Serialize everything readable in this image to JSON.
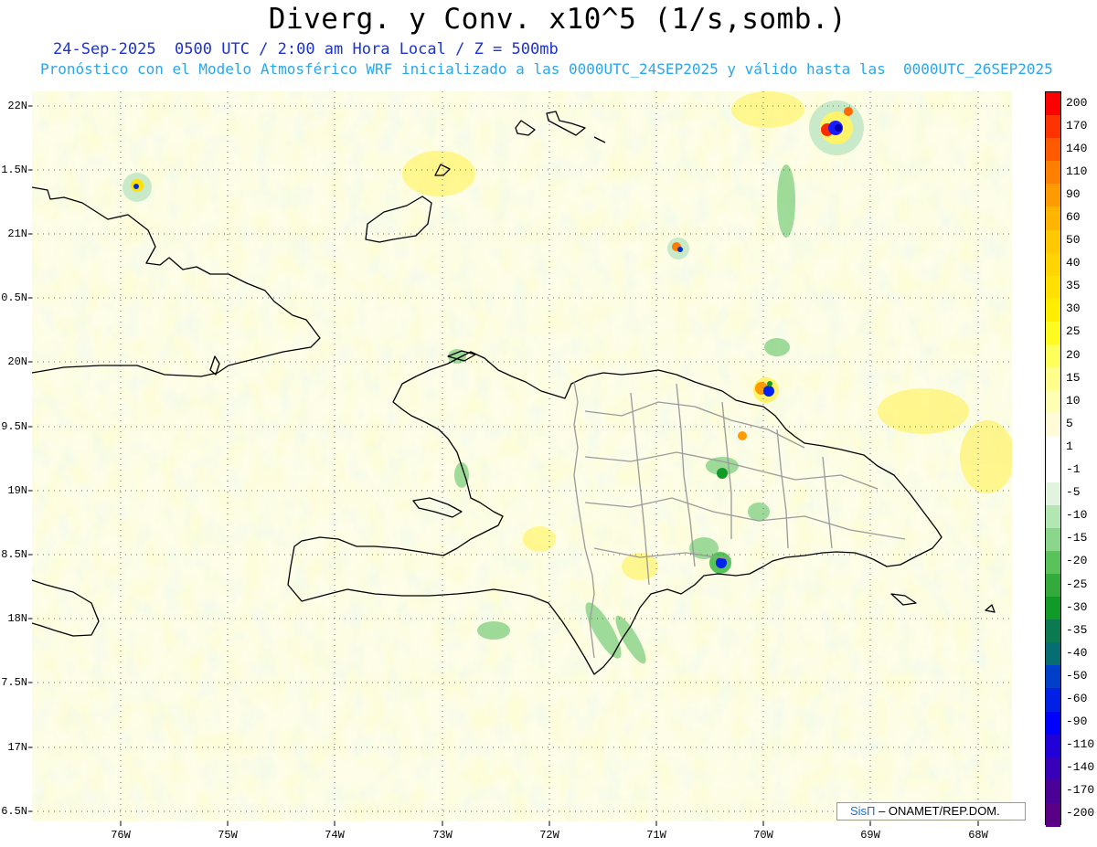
{
  "header": {
    "title": "Diverg. y Conv. x10^5 (1/s,somb.)",
    "subtitle_line1": "24-Sep-2025  0500 UTC / 2:00 am Hora Local / Z = 500mb",
    "subtitle_line2": "Pronóstico con el Modelo Atmosférico WRF inicializado a las 0000UTC_24SEP2025 y válido hasta las  0000UTC_26SEP2025"
  },
  "axes": {
    "lat_labels": [
      "22N",
      "1.5N",
      "21N",
      "0.5N",
      "20N",
      "9.5N",
      "19N",
      "8.5N",
      "18N",
      "7.5N",
      "17N",
      "6.5N"
    ],
    "lon_labels": [
      "76W",
      "75W",
      "74W",
      "73W",
      "72W",
      "71W",
      "70W",
      "69W",
      "68W"
    ]
  },
  "colorbar": {
    "labels": [
      "200",
      "170",
      "140",
      "110",
      "90",
      "60",
      "50",
      "40",
      "35",
      "30",
      "25",
      "20",
      "15",
      "10",
      "5",
      "1",
      "-1",
      "-5",
      "-10",
      "-15",
      "-20",
      "-25",
      "-30",
      "-35",
      "-40",
      "-50",
      "-60",
      "-90",
      "-110",
      "-140",
      "-170",
      "-200"
    ],
    "colors": [
      "#ff0000",
      "#ff3300",
      "#ff5a00",
      "#ff7f00",
      "#ff9b00",
      "#ffb400",
      "#ffc800",
      "#ffd400",
      "#ffe000",
      "#ffee00",
      "#fffa20",
      "#ffff5a",
      "#ffff8c",
      "#ffffb4",
      "#fffad8",
      "#ffffff",
      "#ffffff",
      "#e2f4e0",
      "#b4e6b4",
      "#8cd68c",
      "#5ac25a",
      "#32ab3c",
      "#129a28",
      "#0b7a50",
      "#066e72",
      "#0040c8",
      "#0020e6",
      "#0000ff",
      "#2200d8",
      "#3a00b8",
      "#4a0096",
      "#5a0084"
    ]
  },
  "credit": {
    "logo_text": "SisΠ",
    "org_text": "– ONAMET/REP.DOM."
  },
  "colors": {
    "title": "#000000",
    "subtitle1": "#1a32d6",
    "subtitle2": "#2aa6ee",
    "land_outline": "#000000",
    "province_lines": "#9a9a9a"
  }
}
